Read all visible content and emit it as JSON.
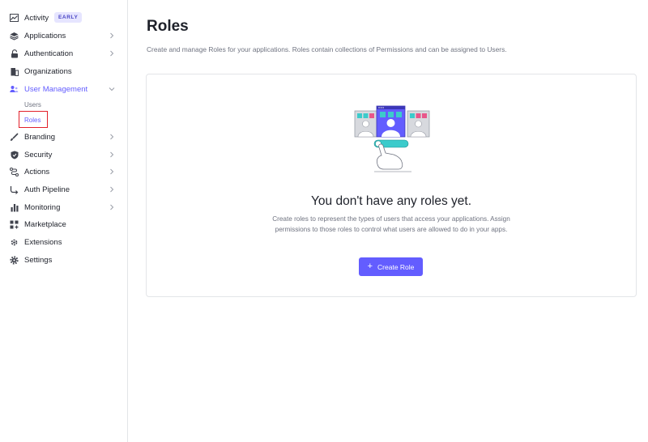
{
  "sidebar": {
    "items": [
      {
        "label": "Activity",
        "icon": "chart-line-icon",
        "badge": "EARLY",
        "chevron": false
      },
      {
        "label": "Applications",
        "icon": "layers-icon",
        "chevron": true
      },
      {
        "label": "Authentication",
        "icon": "lock-icon",
        "chevron": true
      },
      {
        "label": "Organizations",
        "icon": "building-icon",
        "chevron": false
      },
      {
        "label": "User Management",
        "icon": "users-icon",
        "chevron": true,
        "expanded": true
      },
      {
        "label": "Branding",
        "icon": "brush-icon",
        "chevron": true
      },
      {
        "label": "Security",
        "icon": "shield-icon",
        "chevron": true
      },
      {
        "label": "Actions",
        "icon": "flow-icon",
        "chevron": true
      },
      {
        "label": "Auth Pipeline",
        "icon": "pipeline-icon",
        "chevron": true
      },
      {
        "label": "Monitoring",
        "icon": "bar-chart-icon",
        "chevron": true
      },
      {
        "label": "Marketplace",
        "icon": "grid-plus-icon",
        "chevron": false
      },
      {
        "label": "Extensions",
        "icon": "gear-outline-icon",
        "chevron": false
      },
      {
        "label": "Settings",
        "icon": "gear-icon",
        "chevron": false
      }
    ],
    "user_management_sub": [
      {
        "label": "Users"
      },
      {
        "label": "Roles",
        "active": true
      }
    ]
  },
  "main": {
    "title": "Roles",
    "description": "Create and manage Roles for your applications. Roles contain collections of Permissions and can be assigned to Users.",
    "empty_state": {
      "title": "You don't have any roles yet.",
      "description": "Create roles to represent the types of users that access your applications. Assign permissions to those roles to control what users are allowed to do in your apps.",
      "button_label": "Create Role"
    }
  },
  "colors": {
    "accent": "#635dff",
    "selection_outline": "#e2202a",
    "teal": "#3ccbcb",
    "pink": "#e8568a"
  }
}
